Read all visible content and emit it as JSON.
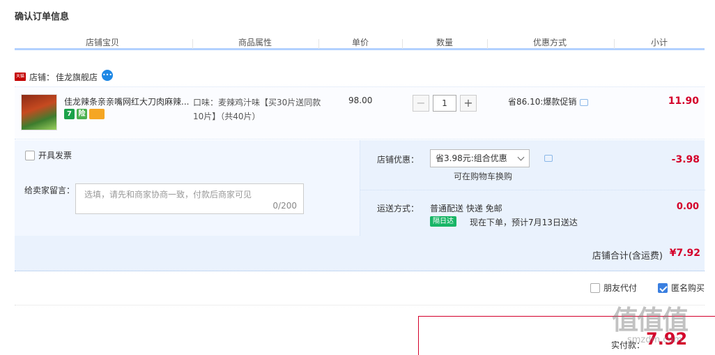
{
  "page": {
    "title": "确认订单信息"
  },
  "columns": [
    "店铺宝贝",
    "商品属性",
    "单价",
    "数量",
    "优惠方式",
    "小计"
  ],
  "shop": {
    "badge": "天猫",
    "label": "店铺：",
    "name": "佳龙旗舰店"
  },
  "item": {
    "title": "佳龙辣条亲亲嘴网红大刀肉麻辣...",
    "attr": "口味：麦辣鸡汁味【买30片送同款10片】（共40片）",
    "price": "98.00",
    "qty": "1",
    "minus": "−",
    "plus": "+",
    "promo": "省86.10:爆款促销",
    "subtotal": "11.90",
    "badges": [
      "7",
      "险",
      ""
    ]
  },
  "invoice": {
    "label": "开具发票",
    "checked": false
  },
  "message": {
    "label": "给卖家留言：",
    "placeholder": "选填，请先和商家协商一致，付款后商家可见",
    "count": "0/200"
  },
  "discount": {
    "label": "店铺优惠：",
    "selected": "省3.98元:组合优惠",
    "note": "可在购物车换购",
    "amount": "-3.98"
  },
  "shipping": {
    "label": "运送方式：",
    "method": "普通配送 快递 免邮",
    "badge": "隔日达",
    "note": "现在下单，预计7月13日送达",
    "fee": "0.00"
  },
  "total": {
    "label": "店铺合计(含运费)",
    "value": "¥7.92"
  },
  "options": {
    "friend_pay": "朋友代付",
    "anonymous": "匿名购买"
  },
  "payment": {
    "label": "实付款：",
    "value": "7.92"
  },
  "watermark": {
    "text": "值值值",
    "sub": "smzdm.com"
  },
  "colors": {
    "price_red": "#d4002a",
    "accent_blue": "#3a7fe0",
    "panel_bg": "#eaf2fd"
  }
}
